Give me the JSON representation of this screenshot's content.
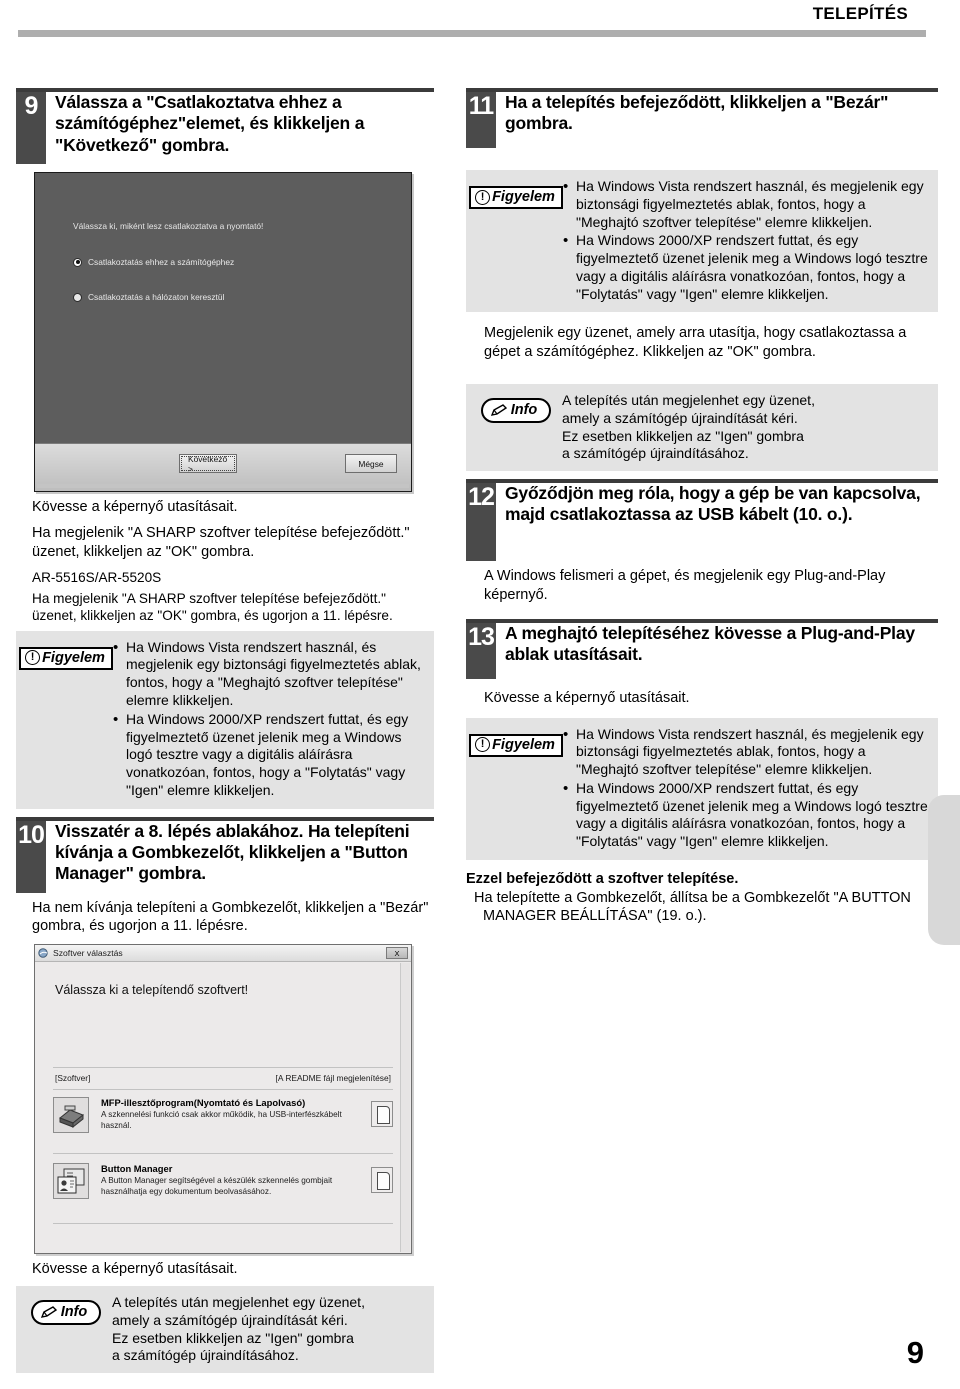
{
  "header": {
    "title": "TELEPÍTÉS"
  },
  "page_number": "9",
  "left_column": {
    "step9": {
      "number": "9",
      "title": "Válassza a \"Csatlakoztatva ehhez a számítógéphez\"elemet, és klikkeljen a \"Következő\" gombra."
    },
    "wizard_screenshot": {
      "prompt": "Válassza ki, miként lesz csatlakoztatva a nyomtató!",
      "option1": "Csatlakoztatás ehhez a számítógéphez",
      "option2": "Csatlakoztatás a hálózaton keresztül",
      "next_button": "Következő >",
      "cancel_button": "Mégse"
    },
    "follow_instructions": "Kövesse a képernyő utasításait.",
    "message_para": "Ha megjelenik \"A SHARP szoftver telepítése befejeződött.\" üzenet, klikkeljen az \"OK\" gombra.",
    "model_label": "AR-5516S/AR-5520S",
    "model_para": "Ha megjelenik \"A SHARP szoftver telepítése befejeződött.\" üzenet, klikkeljen az \"OK\" gombra, és ugorjon a 11. lépésre.",
    "figyelem": {
      "tag": "Figyelem",
      "bullets": [
        "Ha Windows Vista rendszert használ, és megjelenik egy biztonsági figyelmeztetés ablak, fontos, hogy a \"Meghajtó szoftver telepítése\" elemre klikkeljen.",
        "Ha Windows 2000/XP rendszert futtat, és egy figyelmeztető üzenet jelenik meg a Windows logó tesztre vagy a digitális aláírásra vonatkozóan, fontos, hogy a \"Folytatás\" vagy \"Igen\" elemre klikkeljen."
      ]
    },
    "step10": {
      "number": "10",
      "title": "Visszatér a 8. lépés ablakához. Ha telepíteni kívánja a Gombkezelőt, klikkeljen a \"Button Manager\" gombra.",
      "body": "Ha nem kívánja telepíteni a Gombkezelőt, klikkeljen a \"Bezár\" gombra, és ugorjon a 11. lépésre."
    },
    "software_screenshot": {
      "window_title": "Szoftver választás",
      "close_label": "X",
      "heading": "Válassza ki a telepítendő szoftvert!",
      "col_left": "[Szoftver]",
      "col_right": "[A README fájl megjelenítése]",
      "items": [
        {
          "name": "MFP-illesztőprogram(Nyomtató és Lapolvasó)",
          "desc": "A szkennelési funkció csak akkor működik, ha USB-interfészkábelt használ."
        },
        {
          "name": "Button Manager",
          "desc": "A Button Manager segítségével a készülék szkennelés gombjait használhatja egy dokumentum beolvasásához."
        }
      ]
    },
    "follow_instructions2": "Kövesse a képernyő utasításait.",
    "info": {
      "tag": "Info",
      "lines": [
        "A telepítés után megjelenhet egy üzenet,",
        "amely a számítógép újraindítását kéri.",
        "Ez esetben klikkeljen az \"Igen\" gombra",
        "a számítógép újraindításához."
      ]
    }
  },
  "right_column": {
    "step11": {
      "number": "11",
      "title": "Ha a telepítés befejeződött, klikkeljen a \"Bezár\" gombra."
    },
    "figyelem": {
      "tag": "Figyelem",
      "bullets": [
        "Ha Windows Vista rendszert használ, és megjelenik egy biztonsági figyelmeztetés ablak, fontos, hogy a \"Meghajtó szoftver telepítése\" elemre klikkeljen.",
        "Ha Windows 2000/XP rendszert futtat, és egy figyelmeztető üzenet jelenik meg a Windows logó tesztre vagy a digitális aláírásra vonatkozóan, fontos, hogy a \"Folytatás\" vagy \"Igen\" elemre klikkeljen."
      ]
    },
    "message_para": "Megjelenik egy üzenet, amely arra utasítja, hogy csatlakoztassa a gépet a számítógéphez. Klikkeljen az \"OK\" gombra.",
    "info": {
      "tag": "Info",
      "lines": [
        "A telepítés után megjelenhet egy üzenet,",
        "amely a számítógép újraindítását kéri.",
        "Ez esetben klikkeljen az \"Igen\" gombra",
        "a számítógép újraindításához."
      ]
    },
    "step12": {
      "number": "12",
      "title": "Győződjön meg róla, hogy a gép be van kapcsolva, majd csatlakoztassa az USB kábelt (10. o.).",
      "body": "A Windows felismeri a gépet, és megjelenik egy Plug-and-Play képernyő."
    },
    "step13": {
      "number": "13",
      "title": "A meghajtó telepítéséhez kövesse a Plug-and-Play ablak utasításait.",
      "body": "Kövesse a képernyő utasításait."
    },
    "figyelem2": {
      "tag": "Figyelem",
      "bullets": [
        "Ha Windows Vista rendszert használ, és megjelenik egy biztonsági figyelmeztetés ablak, fontos, hogy a \"Meghajtó szoftver telepítése\" elemre klikkeljen.",
        "Ha Windows 2000/XP rendszert futtat, és egy figyelmeztető üzenet jelenik meg a Windows logó tesztre vagy a digitális aláírásra vonatkozóan, fontos, hogy a \"Folytatás\" vagy \"Igen\" elemre klikkeljen."
      ]
    },
    "closing": {
      "bold": "Ezzel befejeződött a szoftver telepítése.",
      "bullet": "Ha telepítette a Gombkezelőt, állítsa be a Gombkezelőt \"A BUTTON MANAGER BEÁLLÍTÁSA\" (19. o.)."
    }
  }
}
